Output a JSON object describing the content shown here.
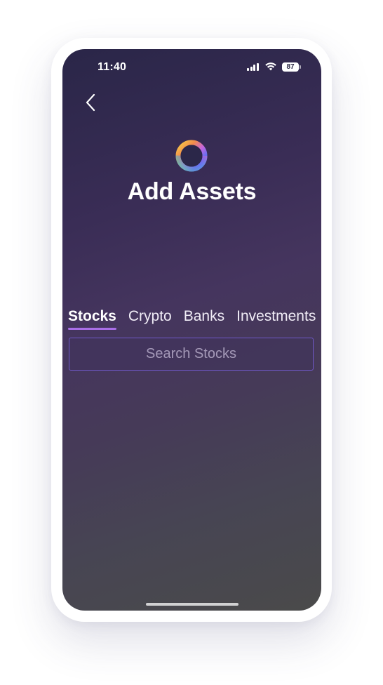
{
  "status_bar": {
    "time": "11:40",
    "battery_level": "87",
    "icons": [
      "signal-icon",
      "wifi-icon",
      "battery-icon"
    ]
  },
  "header": {
    "back_icon": "chevron-left-icon",
    "logo_icon": "rainbow-ring-logo",
    "title": "Add Assets"
  },
  "tabs": [
    {
      "label": "Stocks",
      "active": true
    },
    {
      "label": "Crypto",
      "active": false
    },
    {
      "label": "Banks",
      "active": false
    },
    {
      "label": "Investments",
      "active": false
    }
  ],
  "search": {
    "placeholder": "Search Stocks",
    "value": ""
  },
  "colors": {
    "accent": "#a86ee6",
    "input_border": "#6f58c8",
    "background_top": "#2a2648",
    "background_bottom": "#4a4a4a"
  }
}
